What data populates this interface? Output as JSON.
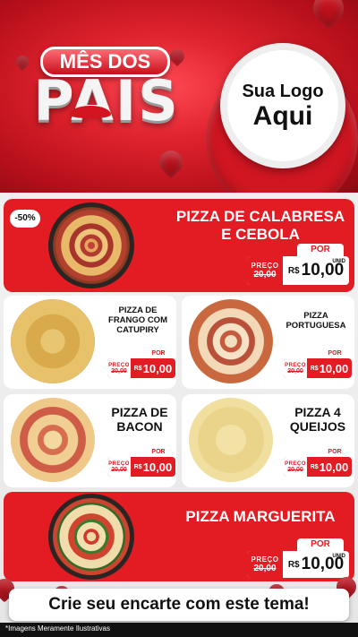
{
  "header": {
    "title_top": "MÊS DOS",
    "title_main": "PAIS",
    "logo_line1": "Sua Logo",
    "logo_line2": "Aqui"
  },
  "price_labels": {
    "preco": "PREÇO",
    "por": "POR",
    "unid": "UNID",
    "old_price": "20,00",
    "currency": "R$",
    "new_price": "10,00"
  },
  "products": [
    {
      "name": "PIZZA DE CALABRESA E CEBOLA",
      "discount": "-50%"
    },
    {
      "name": "PIZZA DE FRANGO COM CATUPIRY"
    },
    {
      "name": "PIZZA PORTUGUESA"
    },
    {
      "name": "PIZZA DE BACON"
    },
    {
      "name": "PIZZA 4 QUEIJOS"
    },
    {
      "name": "PIZZA MARGUERITA"
    }
  ],
  "cta": "Crie seu encarte com este tema!",
  "footer_note": "*Imagens Meramente Ilustrativas",
  "colors": {
    "brand_red": "#e31b23",
    "background": "#eeeeee"
  }
}
